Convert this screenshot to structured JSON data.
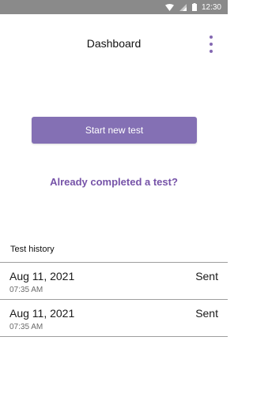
{
  "status_bar": {
    "time": "12:30",
    "icons": [
      "wifi-icon",
      "signal-icon",
      "battery-icon"
    ]
  },
  "app_bar": {
    "title": "Dashboard",
    "menu_icon": "overflow-menu-icon"
  },
  "main": {
    "start_button_label": "Start new test",
    "completed_link_label": "Already completed a test?"
  },
  "history": {
    "header": "Test history",
    "items": [
      {
        "date": "Aug 11, 2021",
        "time": "07:35 AM",
        "status": "Sent"
      },
      {
        "date": "Aug 11, 2021",
        "time": "07:35 AM",
        "status": "Sent"
      }
    ]
  },
  "colors": {
    "accent": "#8470b4",
    "link": "#7653a8",
    "status_bar": "#8a8a8a"
  }
}
